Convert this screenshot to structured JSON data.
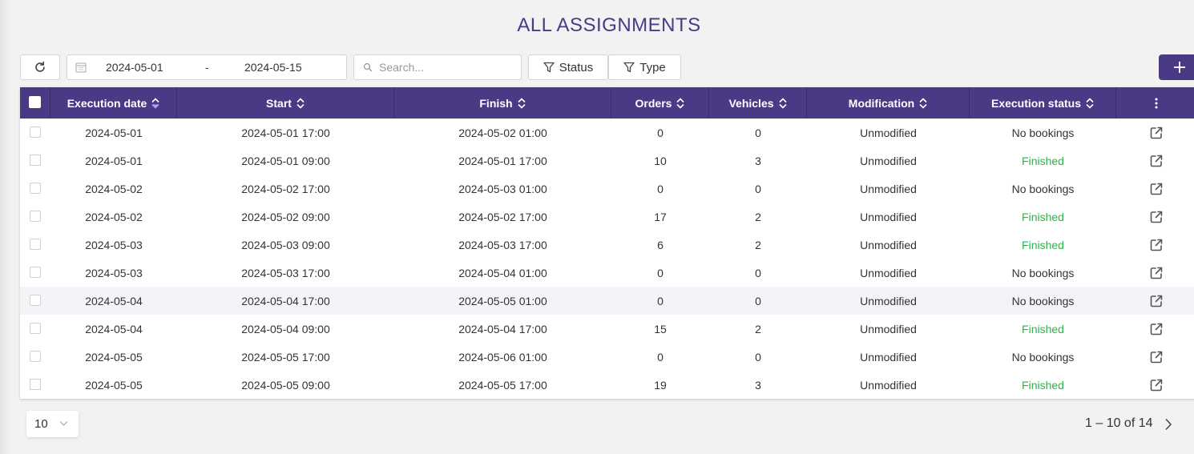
{
  "page": {
    "title": "ALL ASSIGNMENTS"
  },
  "toolbar": {
    "refresh_icon": "refresh-icon",
    "date_from": "2024-05-01",
    "date_separator": "-",
    "date_to": "2024-05-15",
    "search_placeholder": "Search...",
    "status_filter_label": "Status",
    "type_filter_label": "Type",
    "add_icon": "plus-icon"
  },
  "colors": {
    "accent": "#4a3a86",
    "finished": "#2eb24a"
  },
  "table": {
    "columns": [
      {
        "key": "execution_date",
        "label": "Execution date",
        "active_sort": true
      },
      {
        "key": "start",
        "label": "Start"
      },
      {
        "key": "finish",
        "label": "Finish"
      },
      {
        "key": "orders",
        "label": "Orders"
      },
      {
        "key": "vehicles",
        "label": "Vehicles"
      },
      {
        "key": "modification",
        "label": "Modification"
      },
      {
        "key": "execution_status",
        "label": "Execution status"
      }
    ],
    "rows": [
      {
        "execution_date": "2024-05-01",
        "start": "2024-05-01 17:00",
        "finish": "2024-05-02 01:00",
        "orders": "0",
        "vehicles": "0",
        "modification": "Unmodified",
        "execution_status": "No bookings"
      },
      {
        "execution_date": "2024-05-01",
        "start": "2024-05-01 09:00",
        "finish": "2024-05-01 17:00",
        "orders": "10",
        "vehicles": "3",
        "modification": "Unmodified",
        "execution_status": "Finished"
      },
      {
        "execution_date": "2024-05-02",
        "start": "2024-05-02 17:00",
        "finish": "2024-05-03 01:00",
        "orders": "0",
        "vehicles": "0",
        "modification": "Unmodified",
        "execution_status": "No bookings"
      },
      {
        "execution_date": "2024-05-02",
        "start": "2024-05-02 09:00",
        "finish": "2024-05-02 17:00",
        "orders": "17",
        "vehicles": "2",
        "modification": "Unmodified",
        "execution_status": "Finished"
      },
      {
        "execution_date": "2024-05-03",
        "start": "2024-05-03 09:00",
        "finish": "2024-05-03 17:00",
        "orders": "6",
        "vehicles": "2",
        "modification": "Unmodified",
        "execution_status": "Finished"
      },
      {
        "execution_date": "2024-05-03",
        "start": "2024-05-03 17:00",
        "finish": "2024-05-04 01:00",
        "orders": "0",
        "vehicles": "0",
        "modification": "Unmodified",
        "execution_status": "No bookings"
      },
      {
        "execution_date": "2024-05-04",
        "start": "2024-05-04 17:00",
        "finish": "2024-05-05 01:00",
        "orders": "0",
        "vehicles": "0",
        "modification": "Unmodified",
        "execution_status": "No bookings",
        "highlighted": true
      },
      {
        "execution_date": "2024-05-04",
        "start": "2024-05-04 09:00",
        "finish": "2024-05-04 17:00",
        "orders": "15",
        "vehicles": "2",
        "modification": "Unmodified",
        "execution_status": "Finished"
      },
      {
        "execution_date": "2024-05-05",
        "start": "2024-05-05 17:00",
        "finish": "2024-05-06 01:00",
        "orders": "0",
        "vehicles": "0",
        "modification": "Unmodified",
        "execution_status": "No bookings"
      },
      {
        "execution_date": "2024-05-05",
        "start": "2024-05-05 09:00",
        "finish": "2024-05-05 17:00",
        "orders": "19",
        "vehicles": "3",
        "modification": "Unmodified",
        "execution_status": "Finished"
      }
    ]
  },
  "pagination": {
    "page_size": "10",
    "range_text": "1 – 10 of 14"
  }
}
